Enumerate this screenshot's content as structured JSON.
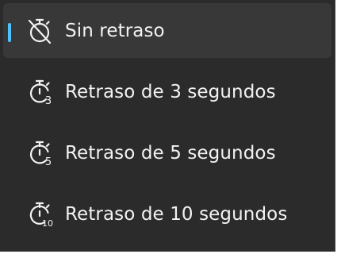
{
  "menu": {
    "items": [
      {
        "label": "Sin retraso",
        "icon": "timer-off-icon",
        "selected": true
      },
      {
        "label": "Retraso de 3 segundos",
        "icon": "timer-3-icon",
        "badge": "3",
        "selected": false
      },
      {
        "label": "Retraso de 5 segundos",
        "icon": "timer-5-icon",
        "badge": "5",
        "selected": false
      },
      {
        "label": "Retraso de 10 segundos",
        "icon": "timer-10-icon",
        "badge": "10",
        "selected": false
      }
    ]
  },
  "colors": {
    "background": "#2b2b2b",
    "selected_background": "#383838",
    "accent": "#4cc2ff",
    "text": "#f2f2f2"
  }
}
